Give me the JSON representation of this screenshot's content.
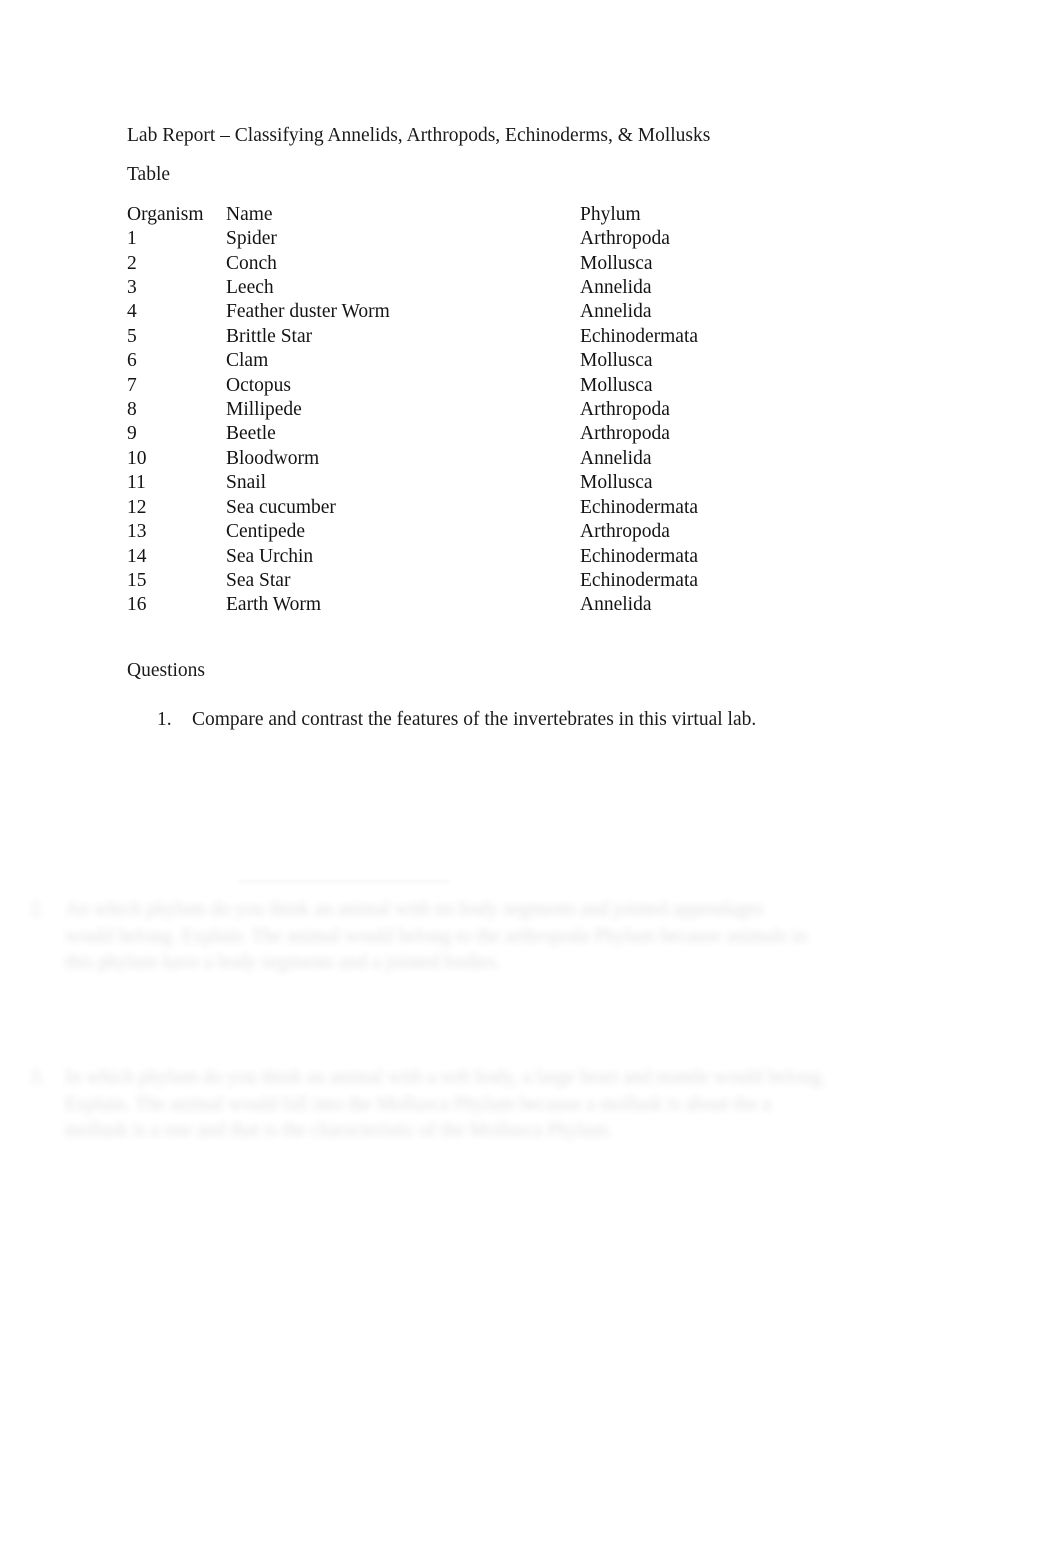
{
  "document": {
    "title": "Lab Report – Classifying Annelids, Arthropods, Echinoderms, & Mollusks",
    "table_label": "Table",
    "questions_label": "Questions"
  },
  "table": {
    "headers": {
      "organism": "Organism",
      "name": "Name",
      "phylum": "Phylum"
    },
    "rows": [
      {
        "organism": "1",
        "name": "Spider",
        "phylum": "Arthropoda"
      },
      {
        "organism": "2",
        "name": "Conch",
        "phylum": "Mollusca"
      },
      {
        "organism": "3",
        "name": "Leech",
        "phylum": "Annelida"
      },
      {
        "organism": "4",
        "name": "Feather duster Worm",
        "phylum": "Annelida"
      },
      {
        "organism": "5",
        "name": "Brittle Star",
        "phylum": "Echinodermata"
      },
      {
        "organism": "6",
        "name": "Clam",
        "phylum": "Mollusca"
      },
      {
        "organism": "7",
        "name": "Octopus",
        "phylum": "Mollusca"
      },
      {
        "organism": "8",
        "name": "Millipede",
        "phylum": "Arthropoda"
      },
      {
        "organism": "9",
        "name": "Beetle",
        "phylum": "Arthropoda"
      },
      {
        "organism": "10",
        "name": "Bloodworm",
        "phylum": "Annelida"
      },
      {
        "organism": "11",
        "name": "Snail",
        "phylum": "Mollusca"
      },
      {
        "organism": "12",
        "name": "Sea cucumber",
        "phylum": "Echinodermata"
      },
      {
        "organism": "13",
        "name": "Centipede",
        "phylum": "Arthropoda"
      },
      {
        "organism": "14",
        "name": "Sea Urchin",
        "phylum": "Echinodermata"
      },
      {
        "organism": "15",
        "name": "Sea Star",
        "phylum": "Echinodermata"
      },
      {
        "organism": "16",
        "name": "Earth Worm",
        "phylum": "Annelida"
      }
    ]
  },
  "questions": [
    {
      "number": "1.",
      "text": "Compare and contrast the features of the invertebrates in this virtual lab."
    }
  ],
  "faded_answers": [
    {
      "number": "2.",
      "text": "An which phylum do you think an animal with no body segments and jointed appendages would belong.  Explain. The animal would belong to the arthropoda Phylum because animals in this phylum have a body segments and a jointed bodies."
    },
    {
      "number": "3.",
      "text": "In which phylum do you think an animal with a soft body, a large heart and mantle would belong.  Explain. The animal would fall into the Mollusca Phylum because a mollusk is about the a mollusk is a one and that is the characteristic of the Mollusca Phylum."
    }
  ]
}
